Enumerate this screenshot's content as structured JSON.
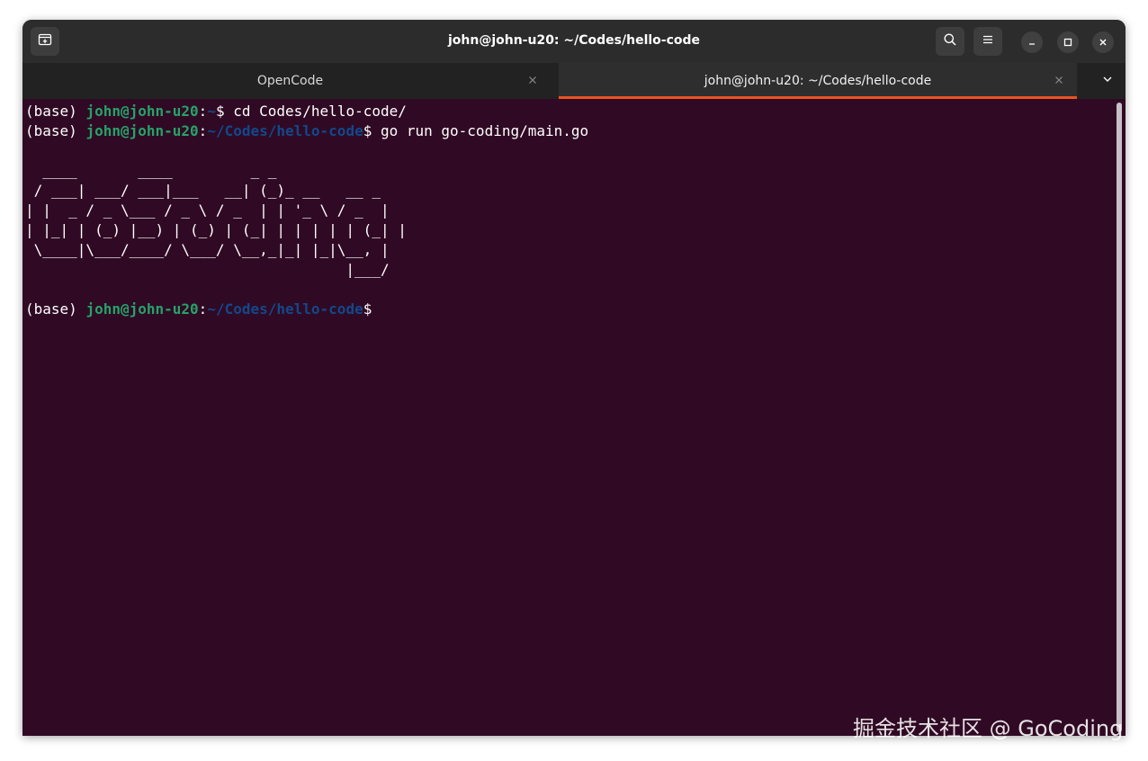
{
  "window": {
    "title": "john@john-u20: ~/Codes/hello-code",
    "icons": {
      "new_tab": "new-tab-icon",
      "search": "search-icon",
      "menu": "hamburger-menu-icon",
      "minimize": "minimize-icon",
      "maximize": "maximize-icon",
      "close": "close-icon"
    }
  },
  "tabs": [
    {
      "label": "OpenCode",
      "active": false
    },
    {
      "label": "john@john-u20: ~/Codes/hello-code",
      "active": true
    }
  ],
  "colors": {
    "terminal_bg": "#300a24",
    "user_host": "#26a269",
    "path": "#12488b",
    "text": "#ffffff",
    "tab_accent": "#e95420"
  },
  "terminal": {
    "line1": {
      "env": "(base) ",
      "user_host": "john@john-u20",
      "colon": ":",
      "path": "~",
      "prompt": "$ ",
      "command": "cd Codes/hello-code/"
    },
    "line2": {
      "env": "(base) ",
      "user_host": "john@john-u20",
      "colon": ":",
      "path": "~/Codes/hello-code",
      "prompt": "$ ",
      "command": "go run go-coding/main.go"
    },
    "ascii_art": [
      "  ____       ____         _ _",
      " / ___| ___/ ___|___   __| (_)_ __   __ _",
      "| |  _ / _ \\___ / _ \\ / _  | | '_ \\ / _  |",
      "| |_| | (_) |__) | (_) | (_| | | | | | (_| |",
      " \\____|\\___/____/ \\___/ \\__,_|_| |_|\\__, |",
      "                                     |___/"
    ],
    "line3": {
      "env": "(base) ",
      "user_host": "john@john-u20",
      "colon": ":",
      "path": "~/Codes/hello-code",
      "prompt": "$"
    }
  },
  "watermark": "掘金技术社区 @ GoCoding"
}
